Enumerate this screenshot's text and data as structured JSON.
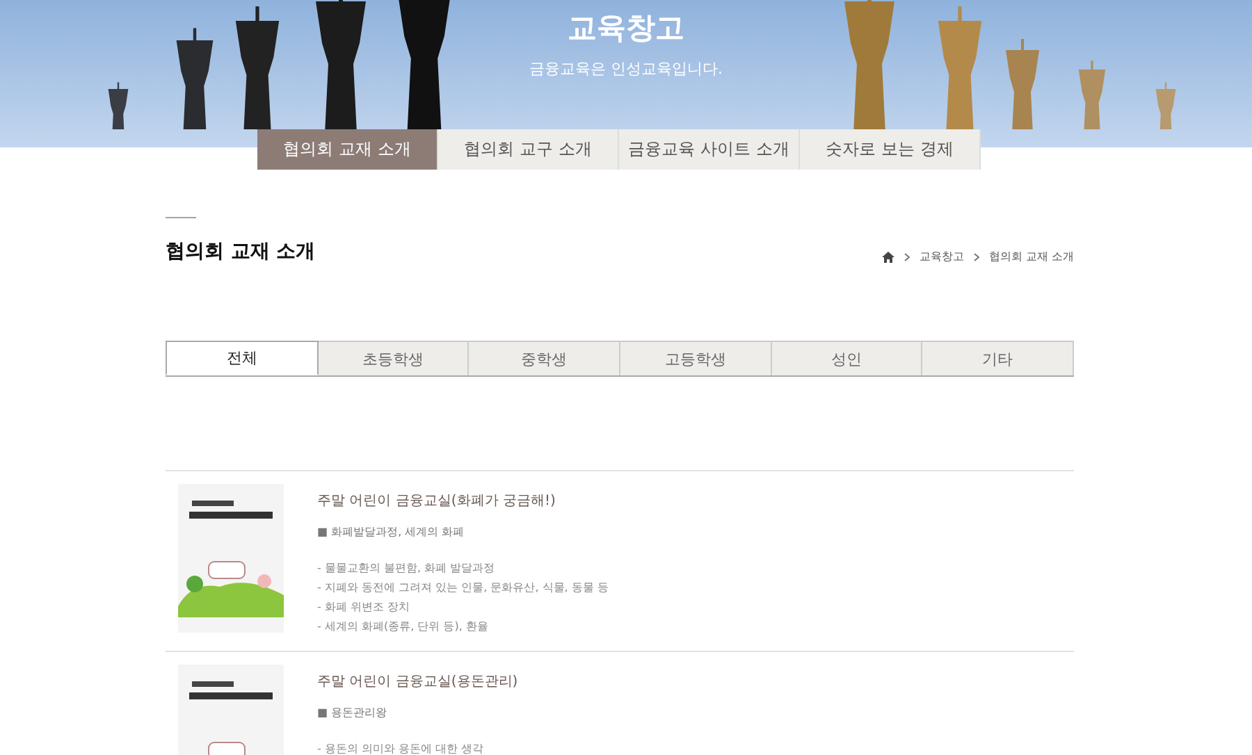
{
  "banner": {
    "title": "교육창고",
    "subtitle": "금융교육은 인성교육입니다."
  },
  "nav_tabs": [
    {
      "label": "협의회 교재 소개",
      "selected": true
    },
    {
      "label": "협의회 교구 소개",
      "selected": false
    },
    {
      "label": "금융교육 사이트 소개",
      "selected": false
    },
    {
      "label": "숫자로 보는 경제",
      "selected": false
    }
  ],
  "page_title": "협의회 교재 소개",
  "breadcrumb": [
    "교육창고",
    "협의회 교재 소개"
  ],
  "filter_tabs": [
    {
      "label": "전체",
      "selected": true
    },
    {
      "label": "초등학생",
      "selected": false
    },
    {
      "label": "중학생",
      "selected": false
    },
    {
      "label": "고등학생",
      "selected": false
    },
    {
      "label": "성인",
      "selected": false
    },
    {
      "label": "기타",
      "selected": false
    }
  ],
  "items": [
    {
      "title": "주말 어린이 금융교실(화폐가 궁금해!)",
      "topic": "■ 화폐발달과정, 세계의 화폐",
      "details": [
        "- 물물교환의 불편함, 화폐 발달과정",
        "- 지폐와 동전에 그려져 있는 인물, 문화유산, 식물, 동물 등",
        "- 화폐 위변조 장치",
        "- 세계의 화폐(종류, 단위 등), 환율"
      ]
    },
    {
      "title": "주말 어린이 금융교실(용돈관리)",
      "topic": "■ 용돈관리왕",
      "details": [
        "- 용돈의 의미와 용돈에 대한 생각"
      ]
    }
  ]
}
